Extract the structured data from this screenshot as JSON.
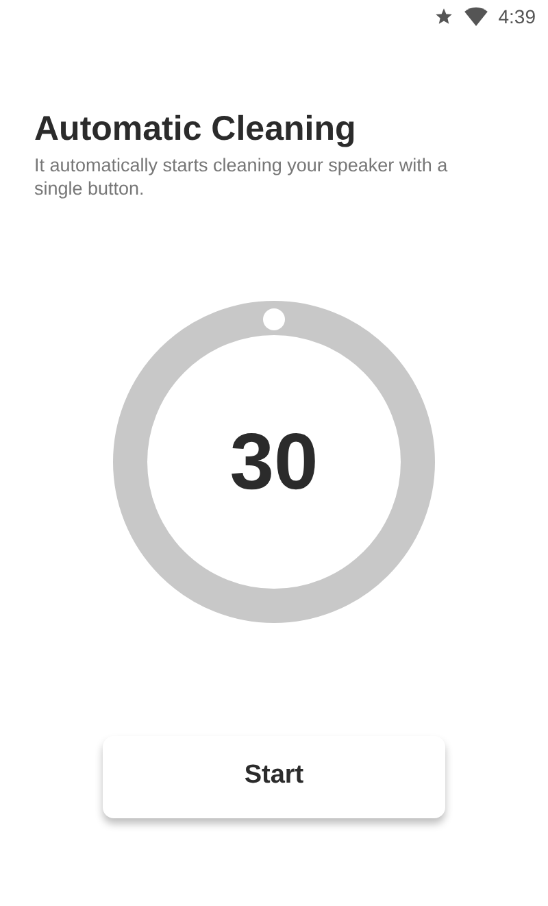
{
  "status_bar": {
    "time": "4:39"
  },
  "title": "Automatic Cleaning",
  "subtitle": "It automatically starts cleaning your speaker with a single button.",
  "dial": {
    "value": "30"
  },
  "button": {
    "label": "Start"
  }
}
